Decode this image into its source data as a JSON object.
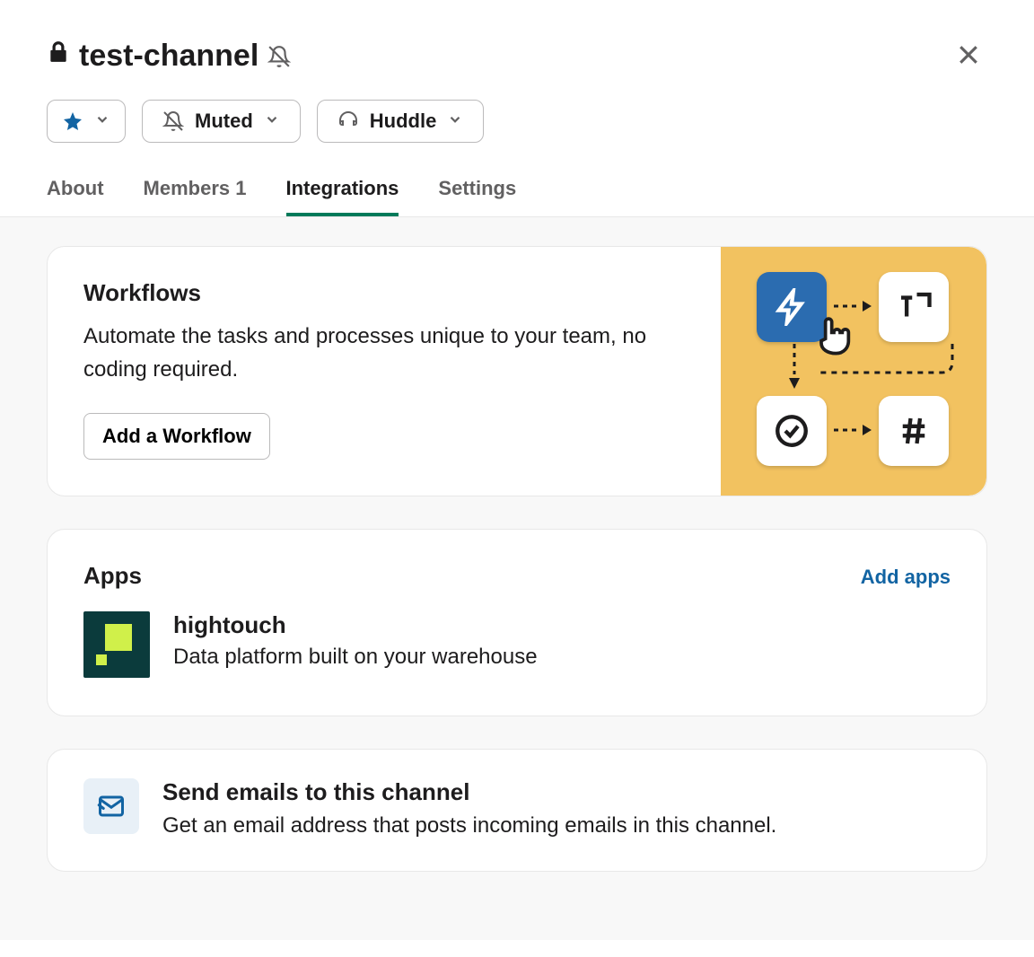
{
  "header": {
    "channel_name": "test-channel",
    "muted_label": "Muted",
    "huddle_label": "Huddle"
  },
  "tabs": {
    "about": "About",
    "members_label": "Members",
    "members_count": "1",
    "integrations": "Integrations",
    "settings": "Settings"
  },
  "workflows": {
    "title": "Workflows",
    "description": "Automate the tasks and processes unique to your team, no coding required.",
    "button": "Add a Workflow"
  },
  "apps": {
    "title": "Apps",
    "add_link": "Add apps",
    "items": [
      {
        "name": "hightouch",
        "description": "Data platform built on your warehouse"
      }
    ]
  },
  "email": {
    "title": "Send emails to this channel",
    "description": "Get an email address that posts incoming emails in this channel."
  }
}
